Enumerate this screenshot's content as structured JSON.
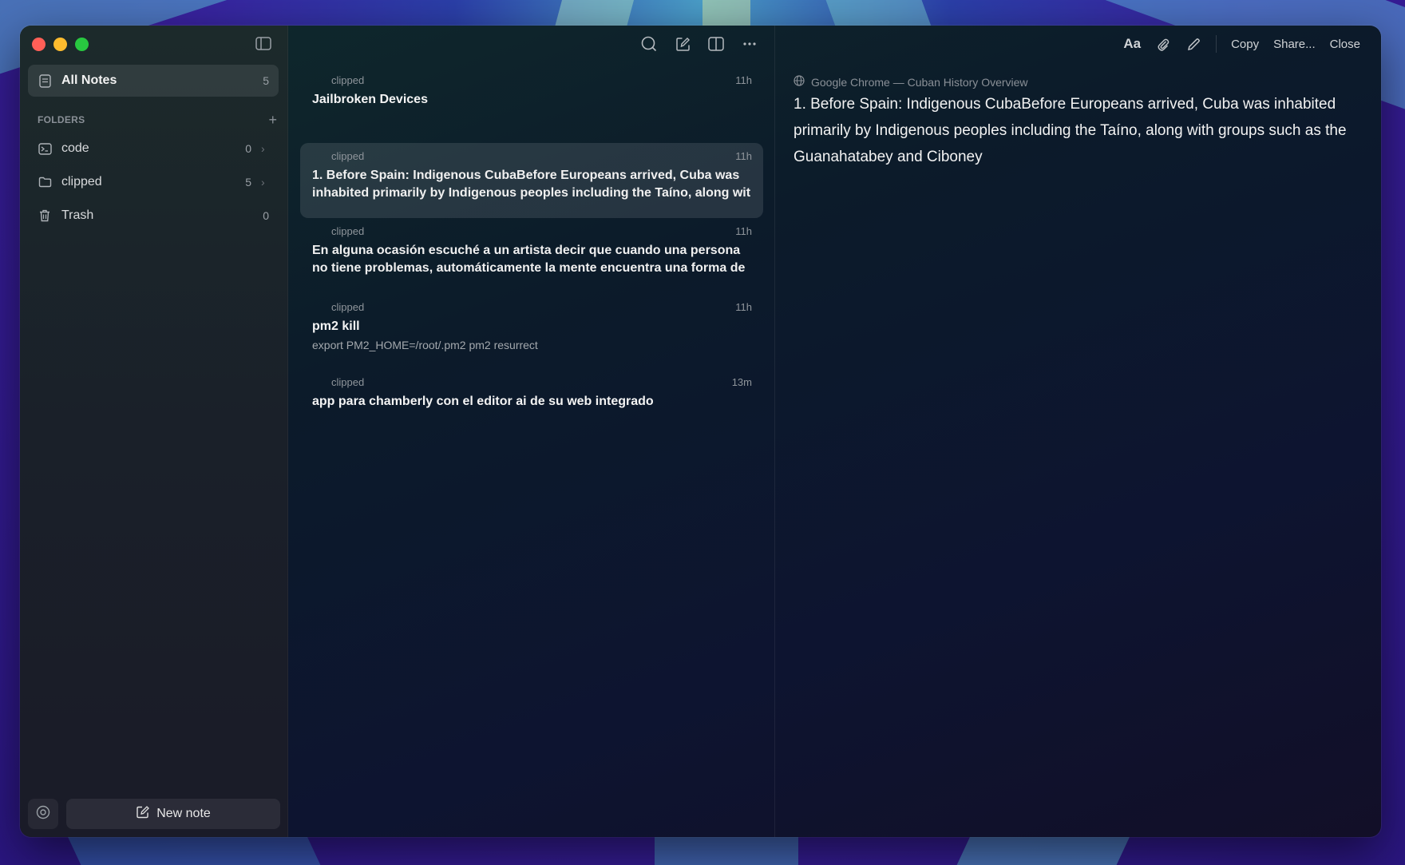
{
  "sidebar": {
    "all_notes": {
      "label": "All Notes",
      "count": "5"
    },
    "folders_header": "FOLDERS",
    "folders": [
      {
        "label": "code",
        "count": "0"
      },
      {
        "label": "clipped",
        "count": "5"
      }
    ],
    "trash": {
      "label": "Trash",
      "count": "0"
    },
    "new_note_label": "New note"
  },
  "notes": [
    {
      "folder": "clipped",
      "time": "11h",
      "title": "Jailbroken Devices",
      "body": "",
      "sub": ""
    },
    {
      "folder": "clipped",
      "time": "11h",
      "title": "",
      "body": "1. Before Spain: Indigenous CubaBefore Europeans arrived, Cuba was inhabited primarily by Indigenous peoples including the Taíno, along wit",
      "sub": ""
    },
    {
      "folder": "clipped",
      "time": "11h",
      "title": "",
      "body": "En alguna ocasión escuché a un artista decir que cuando una persona no tiene problemas, automáticamente la mente encuentra una forma de",
      "sub": ""
    },
    {
      "folder": "clipped",
      "time": "11h",
      "title": "pm2 kill",
      "body": "",
      "sub": "export PM2_HOME=/root/.pm2 pm2 resurrect"
    },
    {
      "folder": "clipped",
      "time": "13m",
      "title": "app para chamberly con el editor ai de su web integrado",
      "body": "",
      "sub": ""
    }
  ],
  "detail": {
    "toolbar": {
      "font": "Aa",
      "copy": "Copy",
      "share": "Share...",
      "close": "Close"
    },
    "source": "Google Chrome — Cuban History Overview",
    "content": "1. Before Spain: Indigenous CubaBefore Europeans arrived, Cuba was inhabited primarily by Indigenous peoples including the Taíno, along with groups such as the Guanahatabey and Ciboney"
  },
  "colors": {
    "close": "#ff5f57",
    "minimize": "#febc2e",
    "zoom": "#28c840"
  }
}
